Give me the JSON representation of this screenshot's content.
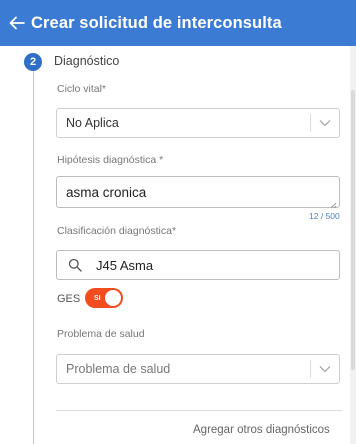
{
  "header": {
    "title": "Crear solicitud de interconsulta",
    "back_icon": "arrow-left-icon"
  },
  "step": {
    "number": "2",
    "title": "Diagnóstico"
  },
  "ciclo_vital": {
    "label": "Ciclo vital*",
    "value": "No Aplica"
  },
  "hipotesis": {
    "label": "Hipótesis diagnóstica *",
    "value": "asma cronica",
    "counter": "12 / 500"
  },
  "clasificacion": {
    "label": "Clasificación diagnóstica*",
    "value": "J45 Asma",
    "icon": "search-icon"
  },
  "ges": {
    "label": "GES",
    "toggle_text": "SI",
    "enabled": true
  },
  "problema": {
    "label": "Problema de salud",
    "placeholder": "Problema de salud"
  },
  "actions": {
    "add_other": "Agregar otros diagnósticos"
  },
  "colors": {
    "header": "#3b7bd4",
    "step_badge": "#2f6fc7",
    "toggle_on": "#f24c1f",
    "counter": "#4a7fc0"
  }
}
